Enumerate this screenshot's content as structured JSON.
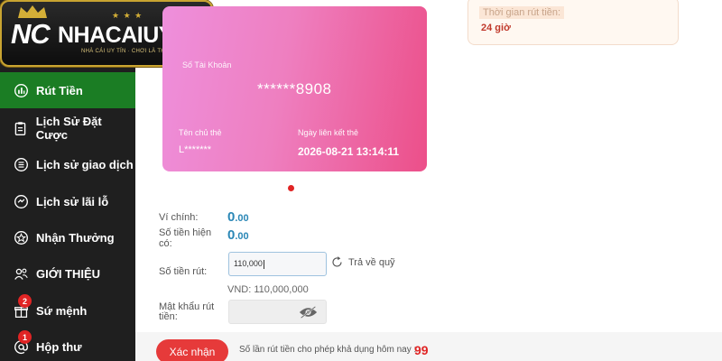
{
  "brand": {
    "logo_nc": "NC",
    "logo_name": "NHACAIUYTIN",
    "logo_slogan": "NHÀ CÁI UY TÍN · CHƠI LÀ THẮNG"
  },
  "sidebar": {
    "items": [
      {
        "label": "Rút Tiền",
        "icon": "chart-icon",
        "active": true
      },
      {
        "label": "Lịch Sử Đặt Cược",
        "icon": "clipboard-icon"
      },
      {
        "label": "Lịch sử giao dịch",
        "icon": "list-circle-icon"
      },
      {
        "label": "Lịch sử lãi lỗ",
        "icon": "profit-loss-icon"
      },
      {
        "label": "Nhận Thưởng",
        "icon": "star-badge-icon"
      },
      {
        "label": "GIỚI THIỆU",
        "icon": "users-icon"
      },
      {
        "label": "Sứ mệnh",
        "icon": "gift-icon",
        "badge": "2"
      },
      {
        "label": "Hộp thư",
        "icon": "at-icon",
        "badge": "1"
      }
    ]
  },
  "card": {
    "account_label": "Số Tài Khoản",
    "account_number": "******8908",
    "holder_label": "Tên chủ thẻ",
    "holder_name": "L*******",
    "linked_date_label": "Ngày liên kết thẻ",
    "linked_date": "2026-08-21 13:14:11"
  },
  "withdraw_time": {
    "label": "Thời gian rút tiền:",
    "value": "24 giờ"
  },
  "form": {
    "main_wallet_label": "Ví chính:",
    "main_wallet_value": "0",
    "main_wallet_decimals": ".00",
    "current_balance_label_1": "Số tiền hiện",
    "current_balance_label_2": "có:",
    "current_balance_value": "0",
    "current_balance_decimals": ".00",
    "amount_label": "Số tiền rút:",
    "amount_value": "110,000",
    "refund_label": "Trả về quỹ",
    "amount_vnd": "VND: 110,000,000",
    "password_label_1": "Mật khẩu rút",
    "password_label_2": "tiền:",
    "submit_label": "Xác nhận",
    "limit_label": "Số lần rút tiền cho phép khả dụng hôm nay :",
    "limit_count": "99"
  },
  "colors": {
    "active_green": "#1b7d24",
    "accent_red": "#e63a3a",
    "value_blue": "#2a87b6"
  }
}
